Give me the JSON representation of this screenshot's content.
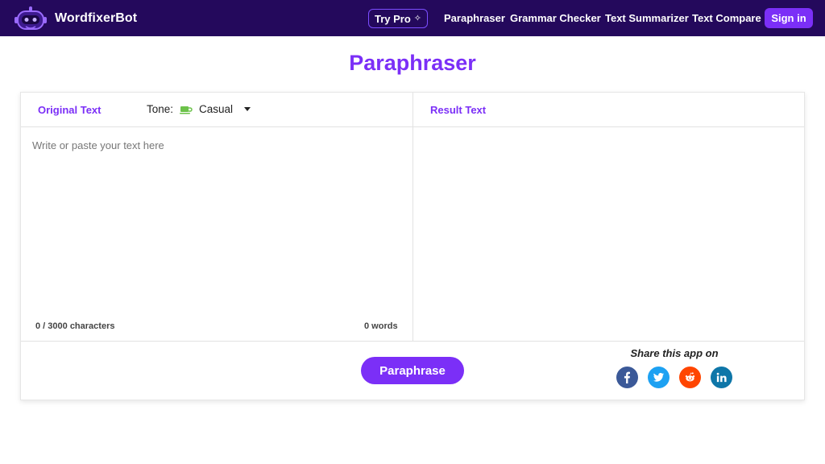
{
  "brand": {
    "name": "WordfixerBot"
  },
  "nav": {
    "try_pro": "Try Pro",
    "links": [
      "Paraphraser",
      "Grammar Checker",
      "Text Summarizer",
      "Text Compare"
    ],
    "sign_in": "Sign in"
  },
  "page": {
    "title": "Paraphraser"
  },
  "editor": {
    "original_tab": "Original Text",
    "tone_label": "Tone:",
    "tone_value": "Casual",
    "placeholder": "Write or paste your text here",
    "char_count": "0 / 3000 characters",
    "word_count": "0 words",
    "result_tab": "Result Text"
  },
  "actions": {
    "paraphrase": "Paraphrase"
  },
  "share": {
    "label": "Share this app on",
    "networks": [
      "facebook",
      "twitter",
      "reddit",
      "linkedin"
    ]
  },
  "colors": {
    "nav_bg": "#24095c",
    "accent": "#7b2ff7",
    "facebook": "#3b5998",
    "twitter": "#1da1f2",
    "reddit": "#ff4500",
    "linkedin": "#0e76a8",
    "tone_icon": "#6cc24a"
  },
  "icons": {
    "logo": "robot-logo-icon",
    "try_pro": "sparkle-icon",
    "tone": "coffee-cup-icon",
    "dropdown": "caret-down-icon"
  }
}
